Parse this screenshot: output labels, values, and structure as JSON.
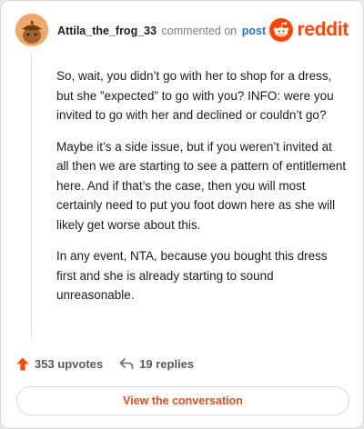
{
  "header": {
    "username": "Attila_the_frog_33",
    "action": "commented on",
    "post_link": "post",
    "brand": "reddit",
    "brand_color": "#ff4500",
    "avatar_icon": "acorn-avatar-icon",
    "brand_icon": "reddit-snoo-icon"
  },
  "comment": {
    "paragraphs": [
      "So, wait, you didn’t go with her to shop for a dress, but she ”expected” to go with you? INFO: were you invited to go with her and declined or couldn’t go?",
      "Maybe it’s a side issue, but if you weren’t invited at all then we are starting to see a pattern of entitlement here. And if that’s the case, then you will most certainly need to put you foot down here as she will likely get worse about this.",
      "In any event, NTA, because you bought this dress first and she is already starting to sound unreasonable."
    ]
  },
  "stats": {
    "upvotes": "353 upvotes",
    "replies": "19 replies",
    "upvote_icon": "upvote-arrow-icon",
    "reply_icon": "reply-arrow-icon"
  },
  "cta": {
    "label": "View the conversation",
    "color": "#e0501b"
  }
}
